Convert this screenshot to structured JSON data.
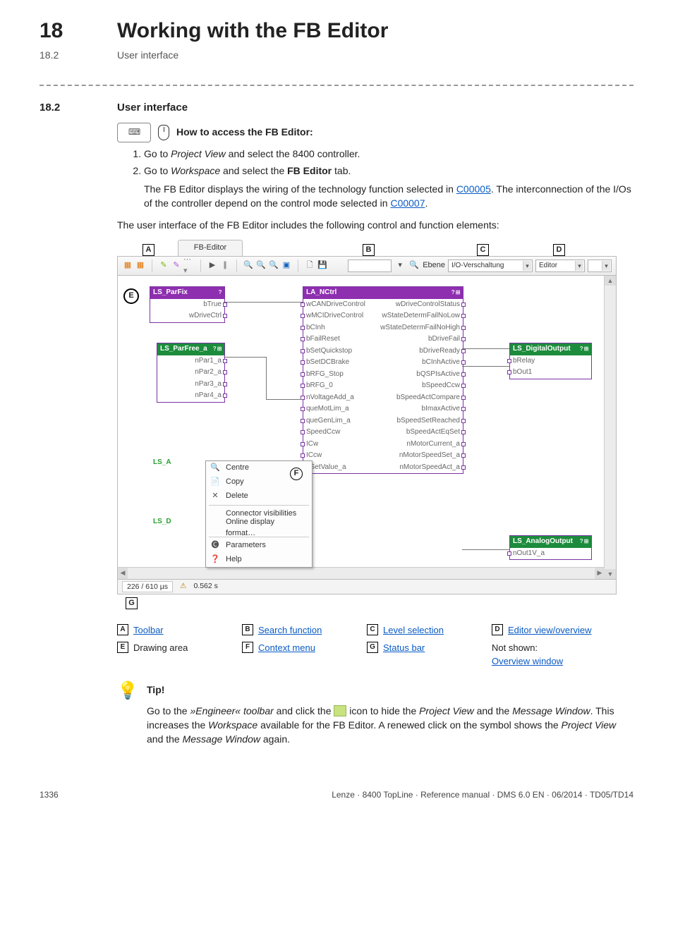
{
  "header": {
    "chapter_no": "18",
    "chapter_title": "Working with the FB Editor",
    "sub_no": "18.2",
    "sub_title": "User interface"
  },
  "section": {
    "number": "18.2",
    "title": "User interface"
  },
  "procedure": {
    "lead": "How to access the FB Editor:",
    "steps": [
      {
        "pre": "Go to ",
        "em": "Project View",
        "post": " and select the 8400 controller."
      },
      {
        "pre": "Go to ",
        "em": "Workspace",
        "post_pre": " and select the ",
        "bold": "FB Editor",
        "post": " tab."
      }
    ],
    "note_pre": "The FB Editor displays the wiring of the technology function selected in ",
    "note_link1": "C00005",
    "note_mid": ". The interconnection of the I/Os of the controller depend on the control mode selected in ",
    "note_link2": "C00007",
    "note_end": "."
  },
  "caption": "The user interface of the FB Editor includes the following control and function elements:",
  "screenshot": {
    "tab_label": "FB-Editor",
    "toolbar": {
      "level_label": "Ebene",
      "level_value": "I/O-Verschaltung",
      "view_value": "Editor"
    },
    "statusbar": {
      "coords": "226 / 610 µs",
      "warning_icon": "⚠",
      "time": "0.562 s"
    },
    "blocks": {
      "parfix": {
        "title": "LS_ParFix",
        "rows": [
          "bTrue",
          "wDriveCtrl"
        ]
      },
      "parfree": {
        "title": "LS_ParFree_a",
        "rows": [
          "nPar1_a",
          "nPar2_a",
          "nPar3_a",
          "nPar4_a"
        ]
      },
      "nctrl": {
        "title": "LA_NCtrl",
        "left": [
          "wCANDriveControl",
          "wMCIDriveControl",
          "bCInh",
          "bFailReset",
          "bSetQuickstop",
          "bSetDCBrake",
          "bRFG_Stop",
          "bRFG_0",
          "nVoltageAdd_a",
          "queMotLim_a",
          "queGenLim_a",
          "SpeedCcw",
          "ICw",
          "ICcw",
          "nSetValue_a"
        ],
        "right": [
          "wDriveControlStatus",
          "wStateDetermFailNoLow",
          "wStateDetermFailNoHigh",
          "bDriveFail",
          "bDriveReady",
          "bCInhActive",
          "bQSPIsActive",
          "bSpeedCcw",
          "bSpeedActCompare",
          "bImaxActive",
          "bSpeedSetReached",
          "bSpeedActEqSet",
          "nMotorCurrent_a",
          "nMotorSpeedSet_a",
          "nMotorSpeedAct_a"
        ]
      },
      "digital": {
        "title": "LS_DigitalOutput",
        "rows": [
          "bRelay",
          "bOut1"
        ]
      },
      "analog": {
        "title": "LS_AnalogOutput",
        "rows": [
          "nOut1V_a"
        ]
      },
      "frag1": "LS_A",
      "frag2": "LS_D"
    },
    "context_menu": [
      {
        "icon": "🔍",
        "label": "Centre"
      },
      {
        "icon": "📄",
        "label": "Copy"
      },
      {
        "icon": "✕",
        "label": "Delete"
      },
      {
        "icon": "",
        "label": "Connector visibilities"
      },
      {
        "icon": "",
        "label": "Online display format…"
      },
      {
        "icon": "🅒",
        "label": "Parameters"
      },
      {
        "icon": "❓",
        "label": "Help"
      }
    ]
  },
  "legend": {
    "A": "Toolbar",
    "B": "Search function",
    "C": "Level selection",
    "D": "Editor view/overview",
    "E": "Drawing area",
    "F": "Context menu",
    "G": "Status bar",
    "not_shown_label": "Not shown:",
    "not_shown_link": "Overview window"
  },
  "tip": {
    "title": "Tip!",
    "body_1": "Go to the ",
    "body_em1": "»Engineer« toolbar",
    "body_2": " and click the ",
    "body_3": " icon to hide the ",
    "body_em2": "Project View",
    "body_4": " and the ",
    "body_em3": "Message Window",
    "body_5": ". This increases the ",
    "body_em4": "Workspace",
    "body_6": " available for the FB Editor. A renewed click on the symbol shows the ",
    "body_em5": "Project View",
    "body_7": " and the ",
    "body_em6": "Message Window",
    "body_8": " again."
  },
  "footer": {
    "page": "1336",
    "ref": "Lenze · 8400 TopLine · Reference manual · DMS 6.0 EN · 06/2014 · TD05/TD14"
  }
}
